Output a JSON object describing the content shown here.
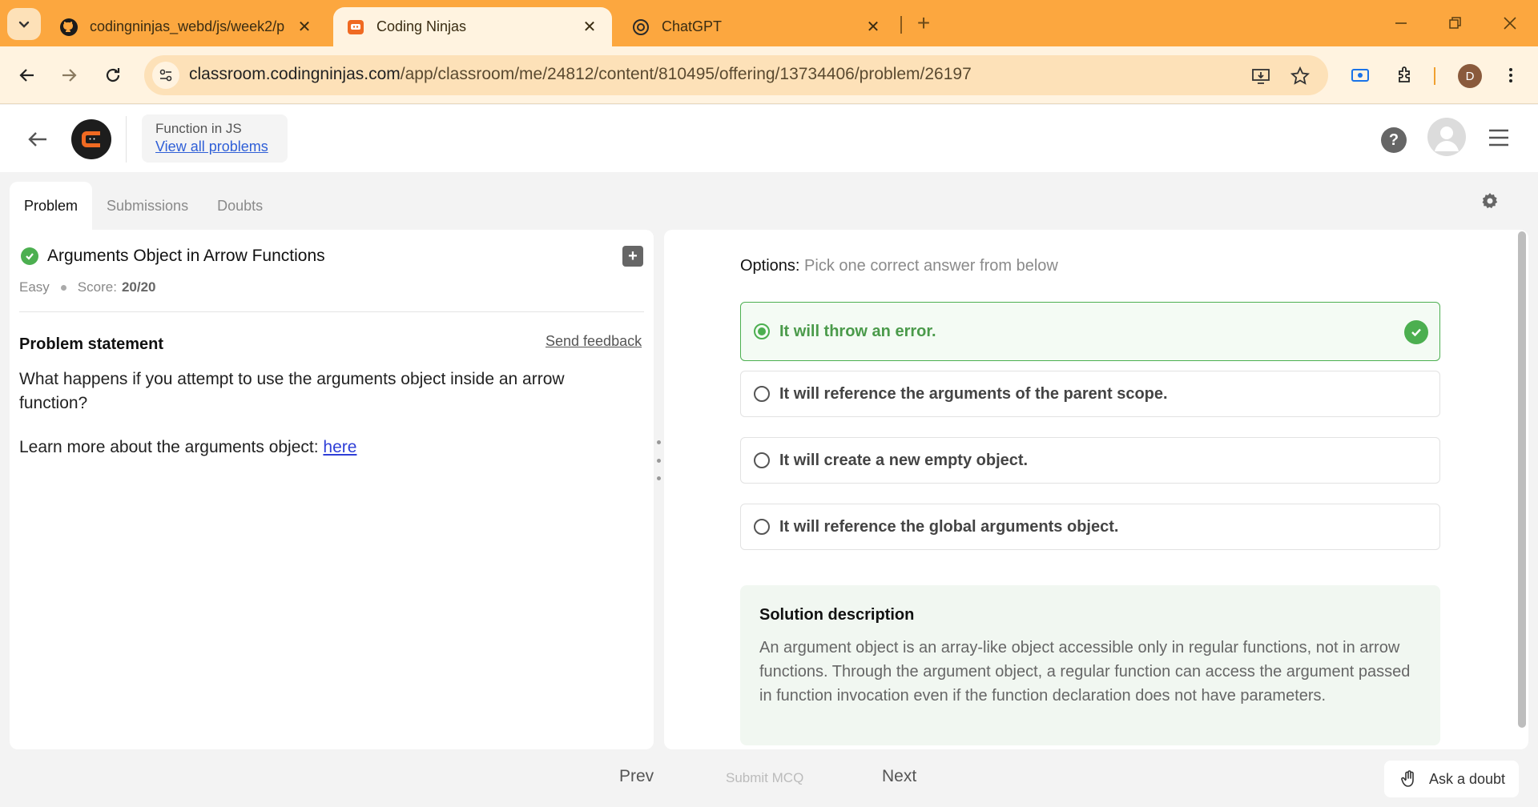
{
  "browser": {
    "tabs": [
      {
        "title": "codingninjas_webd/js/week2/p",
        "favicon": "github-icon",
        "active": false
      },
      {
        "title": "Coding Ninjas",
        "favicon": "coding-ninjas-icon",
        "active": true
      },
      {
        "title": "ChatGPT",
        "favicon": "chatgpt-icon",
        "active": false
      }
    ],
    "url_host": "classroom.codingninjas.com",
    "url_path": "/app/classroom/me/24812/content/810495/offering/13734406/problem/26197",
    "profile_initial": "D",
    "accent_color": "#fca73f"
  },
  "header": {
    "course_title": "Function in JS",
    "view_all_label": "View all problems"
  },
  "page_tabs": [
    {
      "label": "Problem",
      "active": true
    },
    {
      "label": "Submissions",
      "active": false
    },
    {
      "label": "Doubts",
      "active": false
    }
  ],
  "problem": {
    "title": "Arguments Object in Arrow Functions",
    "difficulty": "Easy",
    "score_label": "Score:",
    "score_value": "20/20",
    "statement_heading": "Problem statement",
    "send_feedback": "Send feedback",
    "statement": "What happens if you attempt to use the arguments object inside an arrow function?",
    "learn_more_text": "Learn more about the arguments object: ",
    "learn_more_link": "here"
  },
  "options": {
    "heading": "Options:",
    "hint": "Pick one correct answer from below",
    "items": [
      {
        "text": "It will throw an error.",
        "selected": true,
        "correct": true
      },
      {
        "text": "It will reference the arguments of the parent scope.",
        "selected": false
      },
      {
        "text": "It will create a new empty object.",
        "selected": false
      },
      {
        "text": "It will reference the global arguments object.",
        "selected": false
      }
    ],
    "correct_color": "#4caf50"
  },
  "solution": {
    "heading": "Solution description",
    "body": "An argument object is an array-like object accessible only in regular functions, not in arrow functions. Through the argument object, a regular function can access the argument passed in function invocation even if the function declaration does not have parameters."
  },
  "footer": {
    "prev": "Prev",
    "submit": "Submit MCQ",
    "next": "Next",
    "ask_doubt": "Ask a doubt"
  }
}
